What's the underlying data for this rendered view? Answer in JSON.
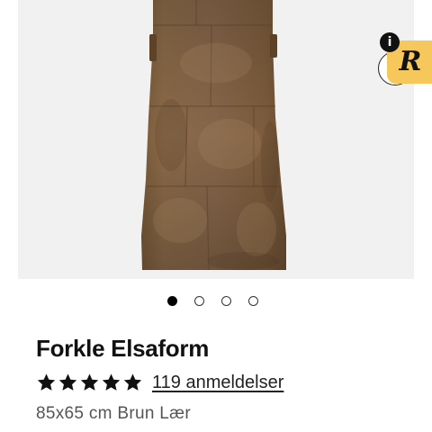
{
  "gallery": {
    "image_alt": "Forkle Elsaform",
    "image_count": 4,
    "active_index": 0,
    "next_button_icon": "chevron-right-icon"
  },
  "reviews_widget": {
    "logo_text": "R",
    "info_text": "i",
    "color": "#f6c75a"
  },
  "product": {
    "title": "Forkle Elsaform",
    "rating": 5,
    "rating_max": 5,
    "review_count_label": "119 anmeldelser",
    "variant": "85x65 cm Brun Lær"
  }
}
